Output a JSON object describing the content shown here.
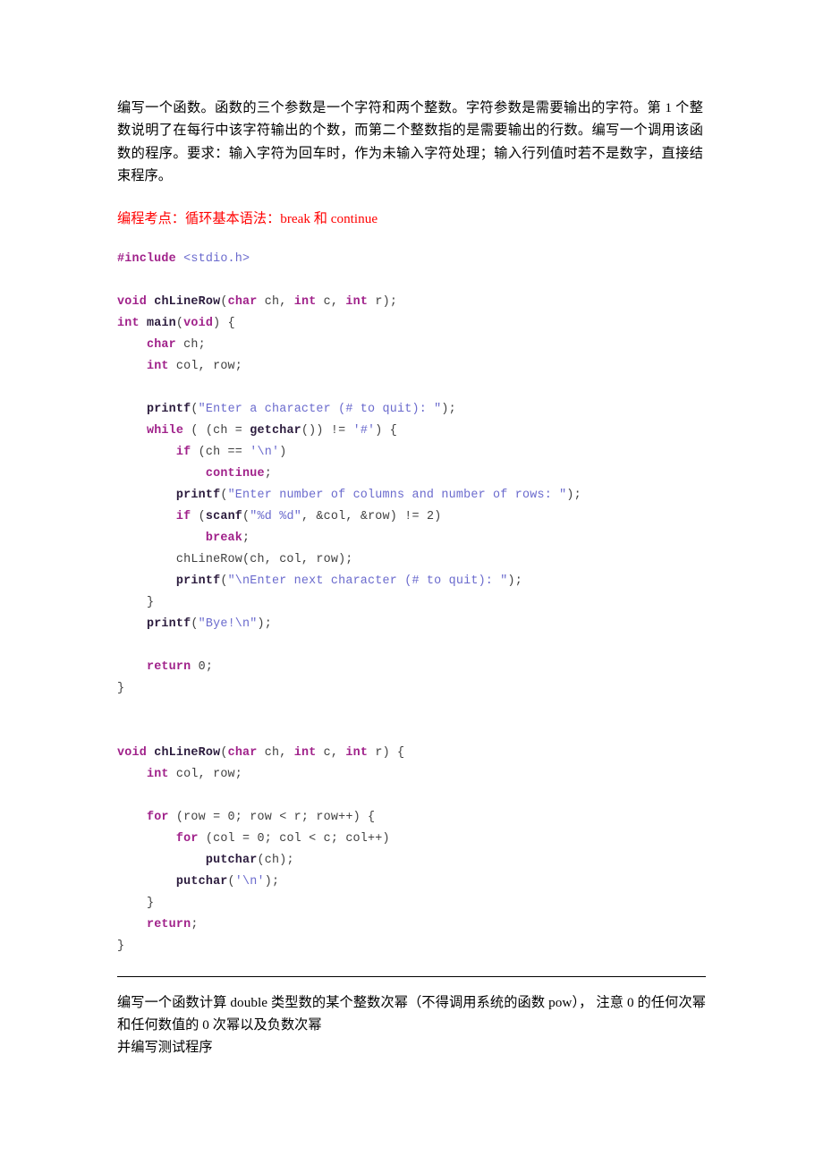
{
  "document": {
    "intro_paragraph": "编写一个函数。函数的三个参数是一个字符和两个整数。字符参数是需要输出的字符。第 1 个整数说明了在每行中该字符输出的个数，而第二个整数指的是需要输出的行数。编写一个调用该函数的程序。要求：输入字符为回车时，作为未输入字符处理；输入行列值时若不是数字，直接结束程序。",
    "red_note": "编程考点：循环基本语法：break 和 continue",
    "code_language": "c",
    "code_lines": [
      {
        "indent": 0,
        "tokens": [
          {
            "t": "pre",
            "s": "#include"
          },
          {
            "t": "pl",
            "s": " "
          },
          {
            "t": "str",
            "s": "<stdio.h>"
          }
        ]
      },
      {
        "indent": 0,
        "tokens": []
      },
      {
        "indent": 0,
        "tokens": [
          {
            "t": "kw",
            "s": "void"
          },
          {
            "t": "pl",
            "s": " "
          },
          {
            "t": "fn",
            "s": "chLineRow"
          },
          {
            "t": "pl",
            "s": "("
          },
          {
            "t": "kw",
            "s": "char"
          },
          {
            "t": "pl",
            "s": " ch, "
          },
          {
            "t": "kw",
            "s": "int"
          },
          {
            "t": "pl",
            "s": " c, "
          },
          {
            "t": "kw",
            "s": "int"
          },
          {
            "t": "pl",
            "s": " r);"
          }
        ]
      },
      {
        "indent": 0,
        "tokens": [
          {
            "t": "kw",
            "s": "int"
          },
          {
            "t": "pl",
            "s": " "
          },
          {
            "t": "fn",
            "s": "main"
          },
          {
            "t": "pl",
            "s": "("
          },
          {
            "t": "kw",
            "s": "void"
          },
          {
            "t": "pl",
            "s": ") {"
          }
        ]
      },
      {
        "indent": 1,
        "tokens": [
          {
            "t": "kw",
            "s": "char"
          },
          {
            "t": "pl",
            "s": " ch;"
          }
        ]
      },
      {
        "indent": 1,
        "tokens": [
          {
            "t": "kw",
            "s": "int"
          },
          {
            "t": "pl",
            "s": " col, row;"
          }
        ]
      },
      {
        "indent": 0,
        "tokens": []
      },
      {
        "indent": 1,
        "tokens": [
          {
            "t": "fn",
            "s": "printf"
          },
          {
            "t": "pl",
            "s": "("
          },
          {
            "t": "str",
            "s": "\"Enter a character (# to quit): \""
          },
          {
            "t": "pl",
            "s": ");"
          }
        ]
      },
      {
        "indent": 1,
        "tokens": [
          {
            "t": "kw",
            "s": "while"
          },
          {
            "t": "pl",
            "s": " ( (ch = "
          },
          {
            "t": "fn",
            "s": "getchar"
          },
          {
            "t": "pl",
            "s": "()) != "
          },
          {
            "t": "str",
            "s": "'#'"
          },
          {
            "t": "pl",
            "s": ") {"
          }
        ]
      },
      {
        "indent": 2,
        "tokens": [
          {
            "t": "kw",
            "s": "if"
          },
          {
            "t": "pl",
            "s": " (ch == "
          },
          {
            "t": "str",
            "s": "'\\n'"
          },
          {
            "t": "pl",
            "s": ")"
          }
        ]
      },
      {
        "indent": 3,
        "tokens": [
          {
            "t": "kw",
            "s": "continue"
          },
          {
            "t": "pl",
            "s": ";"
          }
        ]
      },
      {
        "indent": 2,
        "tokens": [
          {
            "t": "fn",
            "s": "printf"
          },
          {
            "t": "pl",
            "s": "("
          },
          {
            "t": "str",
            "s": "\"Enter number of columns and number of rows: \""
          },
          {
            "t": "pl",
            "s": ");"
          }
        ]
      },
      {
        "indent": 2,
        "tokens": [
          {
            "t": "kw",
            "s": "if"
          },
          {
            "t": "pl",
            "s": " ("
          },
          {
            "t": "fn",
            "s": "scanf"
          },
          {
            "t": "pl",
            "s": "("
          },
          {
            "t": "str",
            "s": "\"%d %d\""
          },
          {
            "t": "pl",
            "s": ", &col, &row) != 2)"
          }
        ]
      },
      {
        "indent": 3,
        "tokens": [
          {
            "t": "kw",
            "s": "break"
          },
          {
            "t": "pl",
            "s": ";"
          }
        ]
      },
      {
        "indent": 2,
        "tokens": [
          {
            "t": "pl",
            "s": "chLineRow(ch, col, row);"
          }
        ]
      },
      {
        "indent": 2,
        "tokens": [
          {
            "t": "fn",
            "s": "printf"
          },
          {
            "t": "pl",
            "s": "("
          },
          {
            "t": "str",
            "s": "\"\\nEnter next character (# to quit): \""
          },
          {
            "t": "pl",
            "s": ");"
          }
        ]
      },
      {
        "indent": 1,
        "tokens": [
          {
            "t": "pl",
            "s": "}"
          }
        ]
      },
      {
        "indent": 1,
        "tokens": [
          {
            "t": "fn",
            "s": "printf"
          },
          {
            "t": "pl",
            "s": "("
          },
          {
            "t": "str",
            "s": "\"Bye!\\n\""
          },
          {
            "t": "pl",
            "s": ");"
          }
        ]
      },
      {
        "indent": 0,
        "tokens": []
      },
      {
        "indent": 1,
        "tokens": [
          {
            "t": "kw",
            "s": "return"
          },
          {
            "t": "pl",
            "s": " 0;"
          }
        ]
      },
      {
        "indent": 0,
        "tokens": [
          {
            "t": "pl",
            "s": "}"
          }
        ]
      },
      {
        "indent": 0,
        "tokens": []
      },
      {
        "indent": 0,
        "tokens": []
      },
      {
        "indent": 0,
        "tokens": [
          {
            "t": "kw",
            "s": "void"
          },
          {
            "t": "pl",
            "s": " "
          },
          {
            "t": "fn",
            "s": "chLineRow"
          },
          {
            "t": "pl",
            "s": "("
          },
          {
            "t": "kw",
            "s": "char"
          },
          {
            "t": "pl",
            "s": " ch, "
          },
          {
            "t": "kw",
            "s": "int"
          },
          {
            "t": "pl",
            "s": " c, "
          },
          {
            "t": "kw",
            "s": "int"
          },
          {
            "t": "pl",
            "s": " r) {"
          }
        ]
      },
      {
        "indent": 1,
        "tokens": [
          {
            "t": "kw",
            "s": "int"
          },
          {
            "t": "pl",
            "s": " col, row;"
          }
        ]
      },
      {
        "indent": 0,
        "tokens": []
      },
      {
        "indent": 1,
        "tokens": [
          {
            "t": "kw",
            "s": "for"
          },
          {
            "t": "pl",
            "s": " (row = 0; row < r; row++) {"
          }
        ]
      },
      {
        "indent": 2,
        "tokens": [
          {
            "t": "kw",
            "s": "for"
          },
          {
            "t": "pl",
            "s": " (col = 0; col < c; col++)"
          }
        ]
      },
      {
        "indent": 3,
        "tokens": [
          {
            "t": "fn",
            "s": "putchar"
          },
          {
            "t": "pl",
            "s": "(ch);"
          }
        ]
      },
      {
        "indent": 2,
        "tokens": [
          {
            "t": "fn",
            "s": "putchar"
          },
          {
            "t": "pl",
            "s": "("
          },
          {
            "t": "str",
            "s": "'\\n'"
          },
          {
            "t": "pl",
            "s": ");"
          }
        ]
      },
      {
        "indent": 1,
        "tokens": [
          {
            "t": "pl",
            "s": "}"
          }
        ]
      },
      {
        "indent": 1,
        "tokens": [
          {
            "t": "kw",
            "s": "return"
          },
          {
            "t": "pl",
            "s": ";"
          }
        ]
      },
      {
        "indent": 0,
        "tokens": [
          {
            "t": "pl",
            "s": "}"
          }
        ]
      }
    ],
    "tail_paragraphs": [
      "编写一个函数计算 double 类型数的某个整数次幂（不得调用系统的函数 pow）， 注意 0 的任何次幂和任何数值的 0 次幂以及负数次幂",
      "并编写测试程序"
    ]
  },
  "colors": {
    "keyword": "#a0218a",
    "function": "#2b1b3d",
    "string": "#6a6acd",
    "plain": "#404040",
    "note": "#ff0000",
    "text": "#000000",
    "background": "#ffffff",
    "rule": "#000000"
  }
}
